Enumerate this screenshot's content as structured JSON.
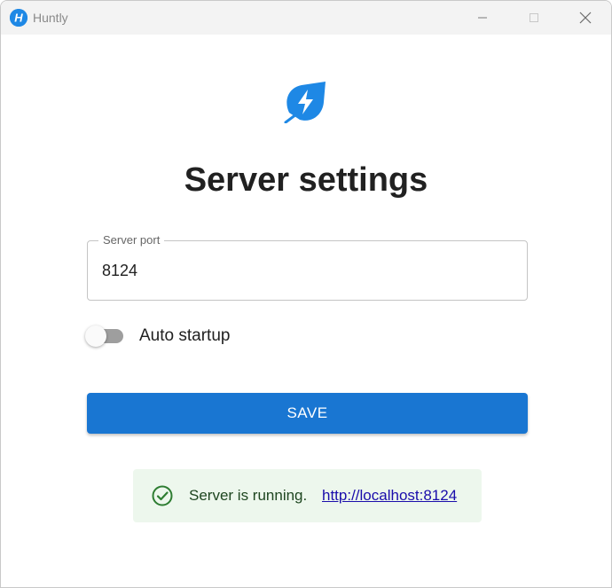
{
  "window": {
    "title": "Huntly",
    "icon": "huntly-h-icon",
    "controls": [
      "minimize-icon",
      "maximize-icon",
      "close-icon"
    ]
  },
  "page": {
    "logo": "leaf-lightning-icon",
    "title": "Server settings"
  },
  "form": {
    "port_label": "Server port",
    "port_value": "8124",
    "auto_startup_label": "Auto startup",
    "auto_startup_enabled": false,
    "save_label": "SAVE"
  },
  "status": {
    "icon": "check-circle-icon",
    "message": "Server is running.",
    "link": "http://localhost:8124"
  },
  "colors": {
    "accent": "#1976d2",
    "logo": "#1e88e5",
    "success_bg": "#edf7ed",
    "success_icon": "#2e7d32",
    "link": "#1a0dab"
  }
}
